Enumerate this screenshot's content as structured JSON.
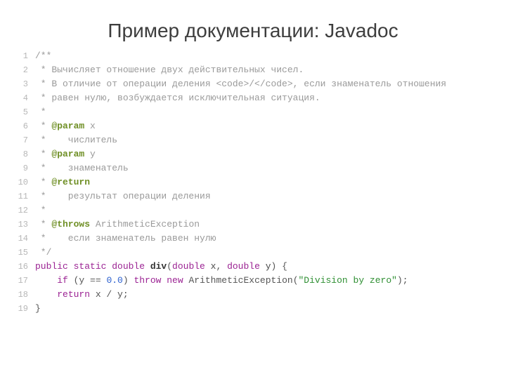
{
  "title": "Пример документации: Javadoc",
  "lines": [
    {
      "n": "1",
      "seg": [
        [
          "comment",
          "/**"
        ]
      ]
    },
    {
      "n": "2",
      "seg": [
        [
          "comment",
          " * Вычисляет отношение двух действительных чисел."
        ]
      ]
    },
    {
      "n": "3",
      "seg": [
        [
          "comment",
          " * В отличие от операции деления <code>/</code>, если знаменатель отношения"
        ]
      ]
    },
    {
      "n": "4",
      "seg": [
        [
          "comment",
          " * равен нулю, возбуждается исключительная ситуация."
        ]
      ]
    },
    {
      "n": "5",
      "seg": [
        [
          "comment",
          " *"
        ]
      ]
    },
    {
      "n": "6",
      "seg": [
        [
          "comment",
          " * "
        ],
        [
          "tag",
          "@param"
        ],
        [
          "comment",
          " x"
        ]
      ]
    },
    {
      "n": "7",
      "seg": [
        [
          "comment",
          " *    числитель"
        ]
      ]
    },
    {
      "n": "8",
      "seg": [
        [
          "comment",
          " * "
        ],
        [
          "tag",
          "@param"
        ],
        [
          "comment",
          " y"
        ]
      ]
    },
    {
      "n": "9",
      "seg": [
        [
          "comment",
          " *    знаменатель"
        ]
      ]
    },
    {
      "n": "10",
      "seg": [
        [
          "comment",
          " * "
        ],
        [
          "tag",
          "@return"
        ]
      ]
    },
    {
      "n": "11",
      "seg": [
        [
          "comment",
          " *    результат операции деления"
        ]
      ]
    },
    {
      "n": "12",
      "seg": [
        [
          "comment",
          " *"
        ]
      ]
    },
    {
      "n": "13",
      "seg": [
        [
          "comment",
          " * "
        ],
        [
          "tag",
          "@throws"
        ],
        [
          "tagtype",
          " ArithmeticException"
        ]
      ]
    },
    {
      "n": "14",
      "seg": [
        [
          "comment",
          " *    если знаменатель равен нулю"
        ]
      ]
    },
    {
      "n": "15",
      "seg": [
        [
          "comment",
          " */"
        ]
      ]
    },
    {
      "n": "16",
      "seg": [
        [
          "keyword",
          "public static "
        ],
        [
          "type",
          "double "
        ],
        [
          "method",
          "div"
        ],
        [
          "paren",
          "("
        ],
        [
          "type",
          "double"
        ],
        [
          "ident",
          " x"
        ],
        [
          "paren",
          ", "
        ],
        [
          "type",
          "double"
        ],
        [
          "ident",
          " y"
        ],
        [
          "paren",
          ") "
        ],
        [
          "brace",
          "{"
        ]
      ]
    },
    {
      "n": "17",
      "seg": [
        [
          "plain",
          "    "
        ],
        [
          "keyword",
          "if"
        ],
        [
          "plain",
          " (y == "
        ],
        [
          "num",
          "0.0"
        ],
        [
          "plain",
          ") "
        ],
        [
          "keyword",
          "throw new"
        ],
        [
          "plain",
          " ArithmeticException("
        ],
        [
          "str",
          "\"Division by zero\""
        ],
        [
          "plain",
          ");"
        ]
      ]
    },
    {
      "n": "18",
      "seg": [
        [
          "plain",
          "    "
        ],
        [
          "keyword",
          "return"
        ],
        [
          "plain",
          " x / y;"
        ]
      ]
    },
    {
      "n": "19",
      "seg": [
        [
          "brace",
          "}"
        ]
      ]
    }
  ]
}
